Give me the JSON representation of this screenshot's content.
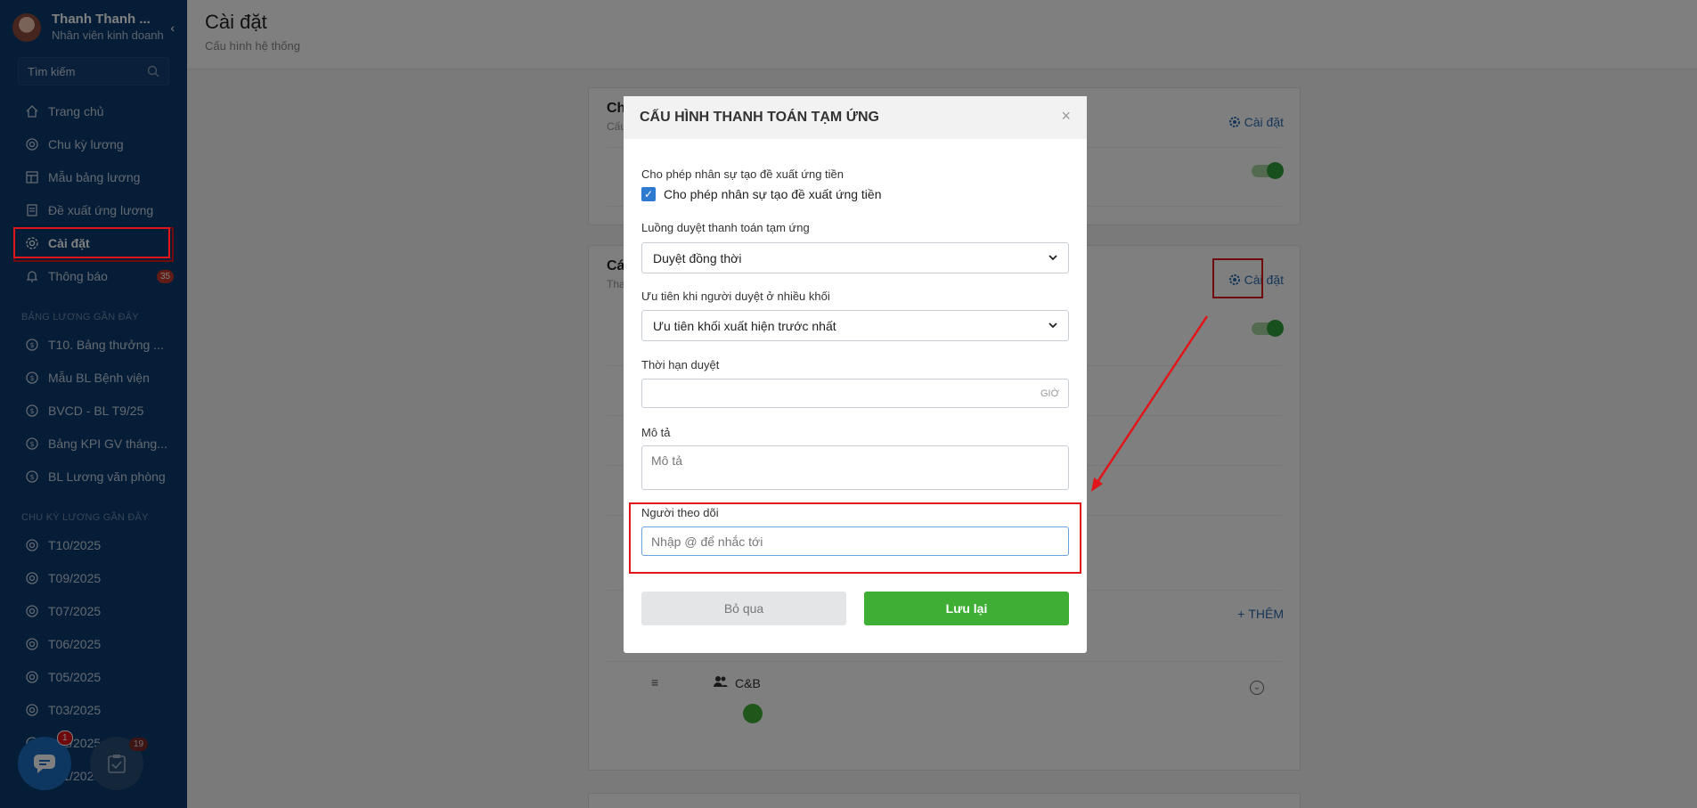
{
  "sidebar": {
    "user_name": "Thanh Thanh ...",
    "user_role": "Nhân viên kinh doanh",
    "search_placeholder": "Tìm kiếm",
    "nav": [
      {
        "label": "Trang chủ",
        "icon": "home-icon"
      },
      {
        "label": "Chu kỳ lương",
        "icon": "cycle-icon"
      },
      {
        "label": "Mẫu bảng lương",
        "icon": "table-icon"
      },
      {
        "label": "Đề xuất ứng lương",
        "icon": "document-icon"
      },
      {
        "label": "Cài đặt",
        "icon": "gear-icon",
        "active": true
      },
      {
        "label": "Thông báo",
        "icon": "bell-icon",
        "badge": "35"
      }
    ],
    "recent_payroll_title": "BẢNG LƯƠNG GẦN ĐÂY",
    "recent_payrolls": [
      "T10. Bảng thưởng ...",
      "Mẫu BL Bệnh viện",
      "BVCD - BL T9/25",
      "Bảng KPI GV tháng...",
      "BL Lương văn phòng"
    ],
    "recent_cycles_title": "CHU KỲ LƯƠNG GẦN ĐÂY",
    "recent_cycles": [
      "T10/2025",
      "T09/2025",
      "T07/2025",
      "T06/2025",
      "T05/2025",
      "T03/2025",
      "T02/2025",
      "T01/2025"
    ],
    "chat_badge": "1",
    "task_badge": "19"
  },
  "header": {
    "title": "Cài đặt",
    "subtitle": "Cấu hình hệ thống"
  },
  "cards": {
    "card1_title": "Ch",
    "card1_sub": "Cấu",
    "card2_title": "Cá",
    "card2_sub": "Tha",
    "settings_link": "Cài đặt",
    "add_label": "THÊM",
    "group_label": "C&B"
  },
  "modal": {
    "title": "CẤU HÌNH THANH TOÁN TẠM ỨNG",
    "close": "×",
    "allow_label": "Cho phép nhân sự tạo đề xuất ứng tiền",
    "allow_checkbox_label": "Cho phép nhân sự tạo đề xuất ứng tiền",
    "allow_checked": true,
    "flow_label": "Luồng duyệt thanh toán tạm ứng",
    "flow_value": "Duyệt đồng thời",
    "priority_label": "Ưu tiên khi người duyệt ở nhiều khối",
    "priority_value": "Ưu tiên khối xuất hiện trước nhất",
    "deadline_label": "Thời hạn duyệt",
    "deadline_unit": "GIỜ",
    "desc_label": "Mô tả",
    "desc_placeholder": "Mô tả",
    "follower_label": "Người theo dõi",
    "follower_placeholder": "Nhập @ để nhắc tới",
    "cancel_label": "Bỏ qua",
    "save_label": "Lưu lại"
  },
  "colors": {
    "sidebar_bg": "#0d3b6e",
    "highlight_red": "#e0161a",
    "save_green": "#3fae35",
    "link_blue": "#2b6cb0"
  }
}
